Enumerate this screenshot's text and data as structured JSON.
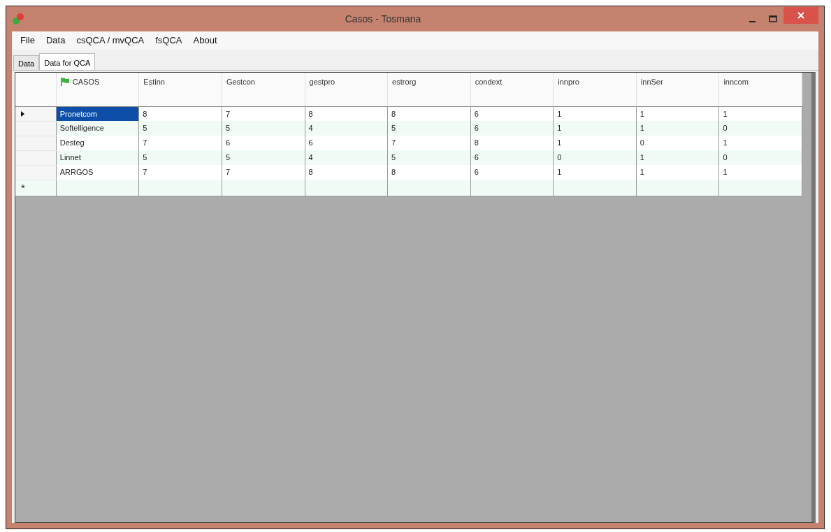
{
  "window": {
    "title": "Casos - Tosmana"
  },
  "menu": [
    "File",
    "Data",
    "csQCA / mvQCA",
    "fsQCA",
    "About"
  ],
  "tabs": [
    {
      "label": "Data",
      "selected": false
    },
    {
      "label": "Data for QCA",
      "selected": true
    }
  ],
  "table": {
    "columns": [
      "CASOS",
      "Estinn",
      "Gestcon",
      "gestpro",
      "estrorg",
      "condext",
      "innpro",
      "innSer",
      "inncom"
    ],
    "rows": [
      {
        "current": true,
        "cells": [
          "Pronetcom",
          "8",
          "7",
          "8",
          "8",
          "6",
          "1",
          "1",
          "1"
        ]
      },
      {
        "current": false,
        "cells": [
          "Softelligence",
          "5",
          "5",
          "4",
          "5",
          "6",
          "1",
          "1",
          "0"
        ]
      },
      {
        "current": false,
        "cells": [
          "Desteg",
          "7",
          "6",
          "6",
          "7",
          "8",
          "1",
          "0",
          "1"
        ]
      },
      {
        "current": false,
        "cells": [
          "Linnet",
          "5",
          "5",
          "4",
          "5",
          "6",
          "0",
          "1",
          "0"
        ]
      },
      {
        "current": false,
        "cells": [
          "ARRGOS",
          "7",
          "7",
          "8",
          "8",
          "6",
          "1",
          "1",
          "1"
        ]
      }
    ],
    "new_row": {
      "marker": "*"
    }
  }
}
